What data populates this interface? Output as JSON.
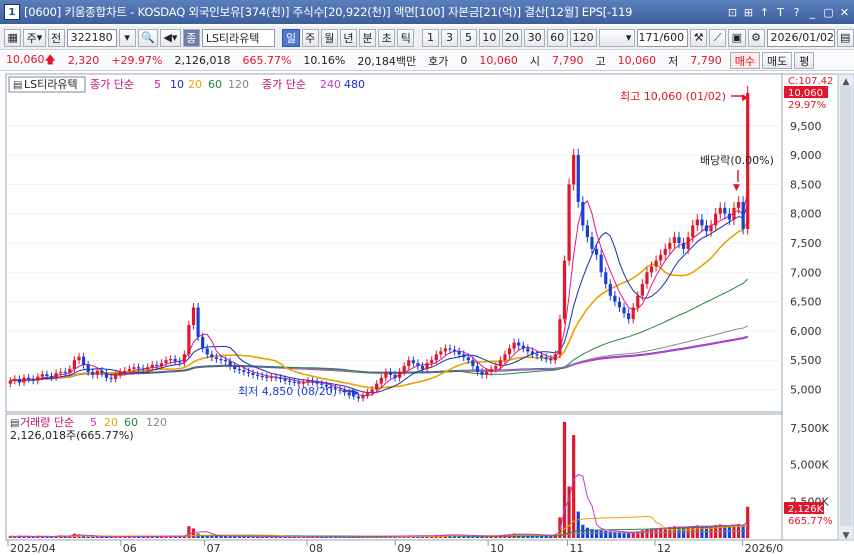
{
  "window": {
    "number": "1",
    "title": "[0600] 키움종합차트 - KOSDAQ 외국인보유[374(천)] 주식수[20,922(천)] 액면[100] 자본금[21(억)] 결산[12월] EPS[-119",
    "buttons": [
      "⊡",
      "⊞",
      "↑",
      "T",
      "?",
      "_",
      "▢",
      "✕"
    ]
  },
  "toolbar": {
    "period_select": "주",
    "market_label": "전",
    "stock_code": "322180",
    "stock_name": "LS티라유텍",
    "stock_badge": "종",
    "interval_buttons": [
      "일",
      "주",
      "월",
      "년",
      "분",
      "초",
      "틱"
    ],
    "interval_active": "일",
    "minute_buttons": [
      "1",
      "3",
      "5",
      "10",
      "20",
      "30",
      "60",
      "120"
    ],
    "count_value": "171",
    "count_total": "/600",
    "date_value": "2026/01/02"
  },
  "quote": {
    "price": "10,060",
    "change": "2,320",
    "change_pct": "+29.97%",
    "volume": "2,126,018",
    "volume_ratio": "665.77%",
    "turnover": "10.16%",
    "amount": "20,184백만",
    "hoga_label": "호가",
    "hoga_value": "0",
    "hoga_price": "10,060",
    "open_label": "시",
    "open": "7,790",
    "high_label": "고",
    "high": "10,060",
    "low_label": "저",
    "low": "7,790",
    "buy_label": "매수",
    "sell_label": "매도",
    "eval_label": "평"
  },
  "chart_data": {
    "type": "candlestick",
    "stock_name": "LS티라유텍",
    "legend_price": "종가 단순",
    "ma_periods": [
      "5",
      "10",
      "20",
      "60",
      "120"
    ],
    "legend_price2": "종가 단순",
    "ma_periods2": [
      "240",
      "480"
    ],
    "ma_colors": {
      "5": "#e0168c",
      "10": "#1a2fb0",
      "20": "#e8a500",
      "60": "#1d8a3c",
      "120": "#888888",
      "240": "#c53ad0",
      "480": "#1b2bd8"
    },
    "up_color": "#e0162b",
    "down_color": "#1a3fd6",
    "y_axis_labels": [
      "9,500",
      "9,000",
      "8,500",
      "8,000",
      "7,500",
      "7,000",
      "6,500",
      "6,000",
      "5,500",
      "5,000"
    ],
    "y_axis_values": [
      9500,
      9000,
      8500,
      8000,
      7500,
      7000,
      6500,
      6000,
      5500,
      5000
    ],
    "ylim": [
      4650,
      10350
    ],
    "x_axis_labels": [
      "2025/04",
      "06",
      "07",
      "08",
      "09",
      "10",
      "11",
      "12",
      "2026/0"
    ],
    "current_price_tag": "10,060",
    "current_pct_tag": "29.97%",
    "top_label": "C:107.42",
    "high_annotation": "최고 10,060 (01/02)",
    "low_annotation": "최저 4,850 (08/20)",
    "dividend_annotation": "배당락(0.00%)",
    "volume": {
      "legend": "거래량 단순",
      "ma_periods": [
        "5",
        "20",
        "60",
        "120"
      ],
      "ma_colors": {
        "5": "#c53ad0",
        "20": "#e8a500",
        "60": "#1d8a3c",
        "120": "#888888"
      },
      "current_text": "2,126,018주(665.77%)",
      "y_axis_labels": [
        "7,500K",
        "5,000K",
        "2,500K"
      ],
      "y_axis_values": [
        7500,
        5000,
        2500
      ],
      "ylim": [
        0,
        8300
      ],
      "current_tag": "2,126K",
      "current_pct_tag": "665.77%"
    },
    "closes": [
      5150,
      5180,
      5120,
      5200,
      5180,
      5150,
      5220,
      5260,
      5230,
      5210,
      5280,
      5300,
      5280,
      5350,
      5500,
      5560,
      5420,
      5300,
      5250,
      5320,
      5280,
      5200,
      5180,
      5250,
      5300,
      5320,
      5350,
      5380,
      5360,
      5340,
      5380,
      5420,
      5400,
      5450,
      5500,
      5520,
      5480,
      5460,
      5600,
      6100,
      6400,
      5900,
      5700,
      5600,
      5550,
      5520,
      5500,
      5480,
      5400,
      5350,
      5330,
      5300,
      5280,
      5250,
      5230,
      5220,
      5200,
      5210,
      5200,
      5180,
      5150,
      5130,
      5120,
      5100,
      5120,
      5150,
      5130,
      5100,
      5080,
      5050,
      5020,
      5000,
      4980,
      4950,
      4900,
      4880,
      4850,
      4900,
      4950,
      5000,
      5100,
      5200,
      5300,
      5250,
      5200,
      5300,
      5400,
      5500,
      5450,
      5400,
      5350,
      5450,
      5500,
      5600,
      5650,
      5700,
      5680,
      5650,
      5600,
      5550,
      5500,
      5400,
      5300,
      5250,
      5300,
      5350,
      5400,
      5500,
      5600,
      5700,
      5800,
      5750,
      5700,
      5650,
      5600,
      5580,
      5550,
      5520,
      5500,
      5600,
      6200,
      7200,
      8500,
      9000,
      8200,
      7800,
      7600,
      7400,
      7300,
      7000,
      6800,
      6600,
      6500,
      6400,
      6300,
      6200,
      6400,
      6600,
      6800,
      7000,
      7100,
      7200,
      7300,
      7400,
      7500,
      7600,
      7500,
      7400,
      7600,
      7800,
      7900,
      7800,
      7700,
      7800,
      8000,
      8100,
      8000,
      7900,
      8100,
      8200,
      7740,
      10060
    ],
    "volumes": [
      120,
      80,
      150,
      90,
      110,
      70,
      140,
      100,
      95,
      85,
      130,
      180,
      160,
      140,
      300,
      250,
      120,
      90,
      100,
      110,
      95,
      85,
      80,
      90,
      100,
      105,
      120,
      110,
      100,
      95,
      105,
      115,
      110,
      120,
      130,
      140,
      120,
      115,
      150,
      800,
      650,
      300,
      200,
      180,
      160,
      150,
      140,
      130,
      120,
      115,
      110,
      100,
      95,
      90,
      85,
      80,
      85,
      82,
      80,
      78,
      75,
      72,
      70,
      68,
      70,
      75,
      72,
      70,
      68,
      65,
      62,
      60,
      58,
      55,
      52,
      50,
      48,
      55,
      60,
      70,
      90,
      120,
      140,
      120,
      110,
      130,
      150,
      180,
      160,
      140,
      120,
      150,
      170,
      200,
      210,
      230,
      220,
      200,
      180,
      170,
      160,
      140,
      120,
      110,
      130,
      150,
      170,
      200,
      230,
      260,
      300,
      280,
      260,
      240,
      220,
      200,
      190,
      180,
      170,
      260,
      1400,
      7900,
      3500,
      7000,
      1800,
      900,
      700,
      600,
      550,
      500,
      480,
      450,
      420,
      400,
      380,
      370,
      420,
      460,
      520,
      580,
      620,
      650,
      700,
      720,
      750,
      800,
      760,
      720,
      780,
      820,
      860,
      820,
      780,
      800,
      880,
      920,
      860,
      820,
      900,
      950,
      780,
      2126
    ]
  }
}
